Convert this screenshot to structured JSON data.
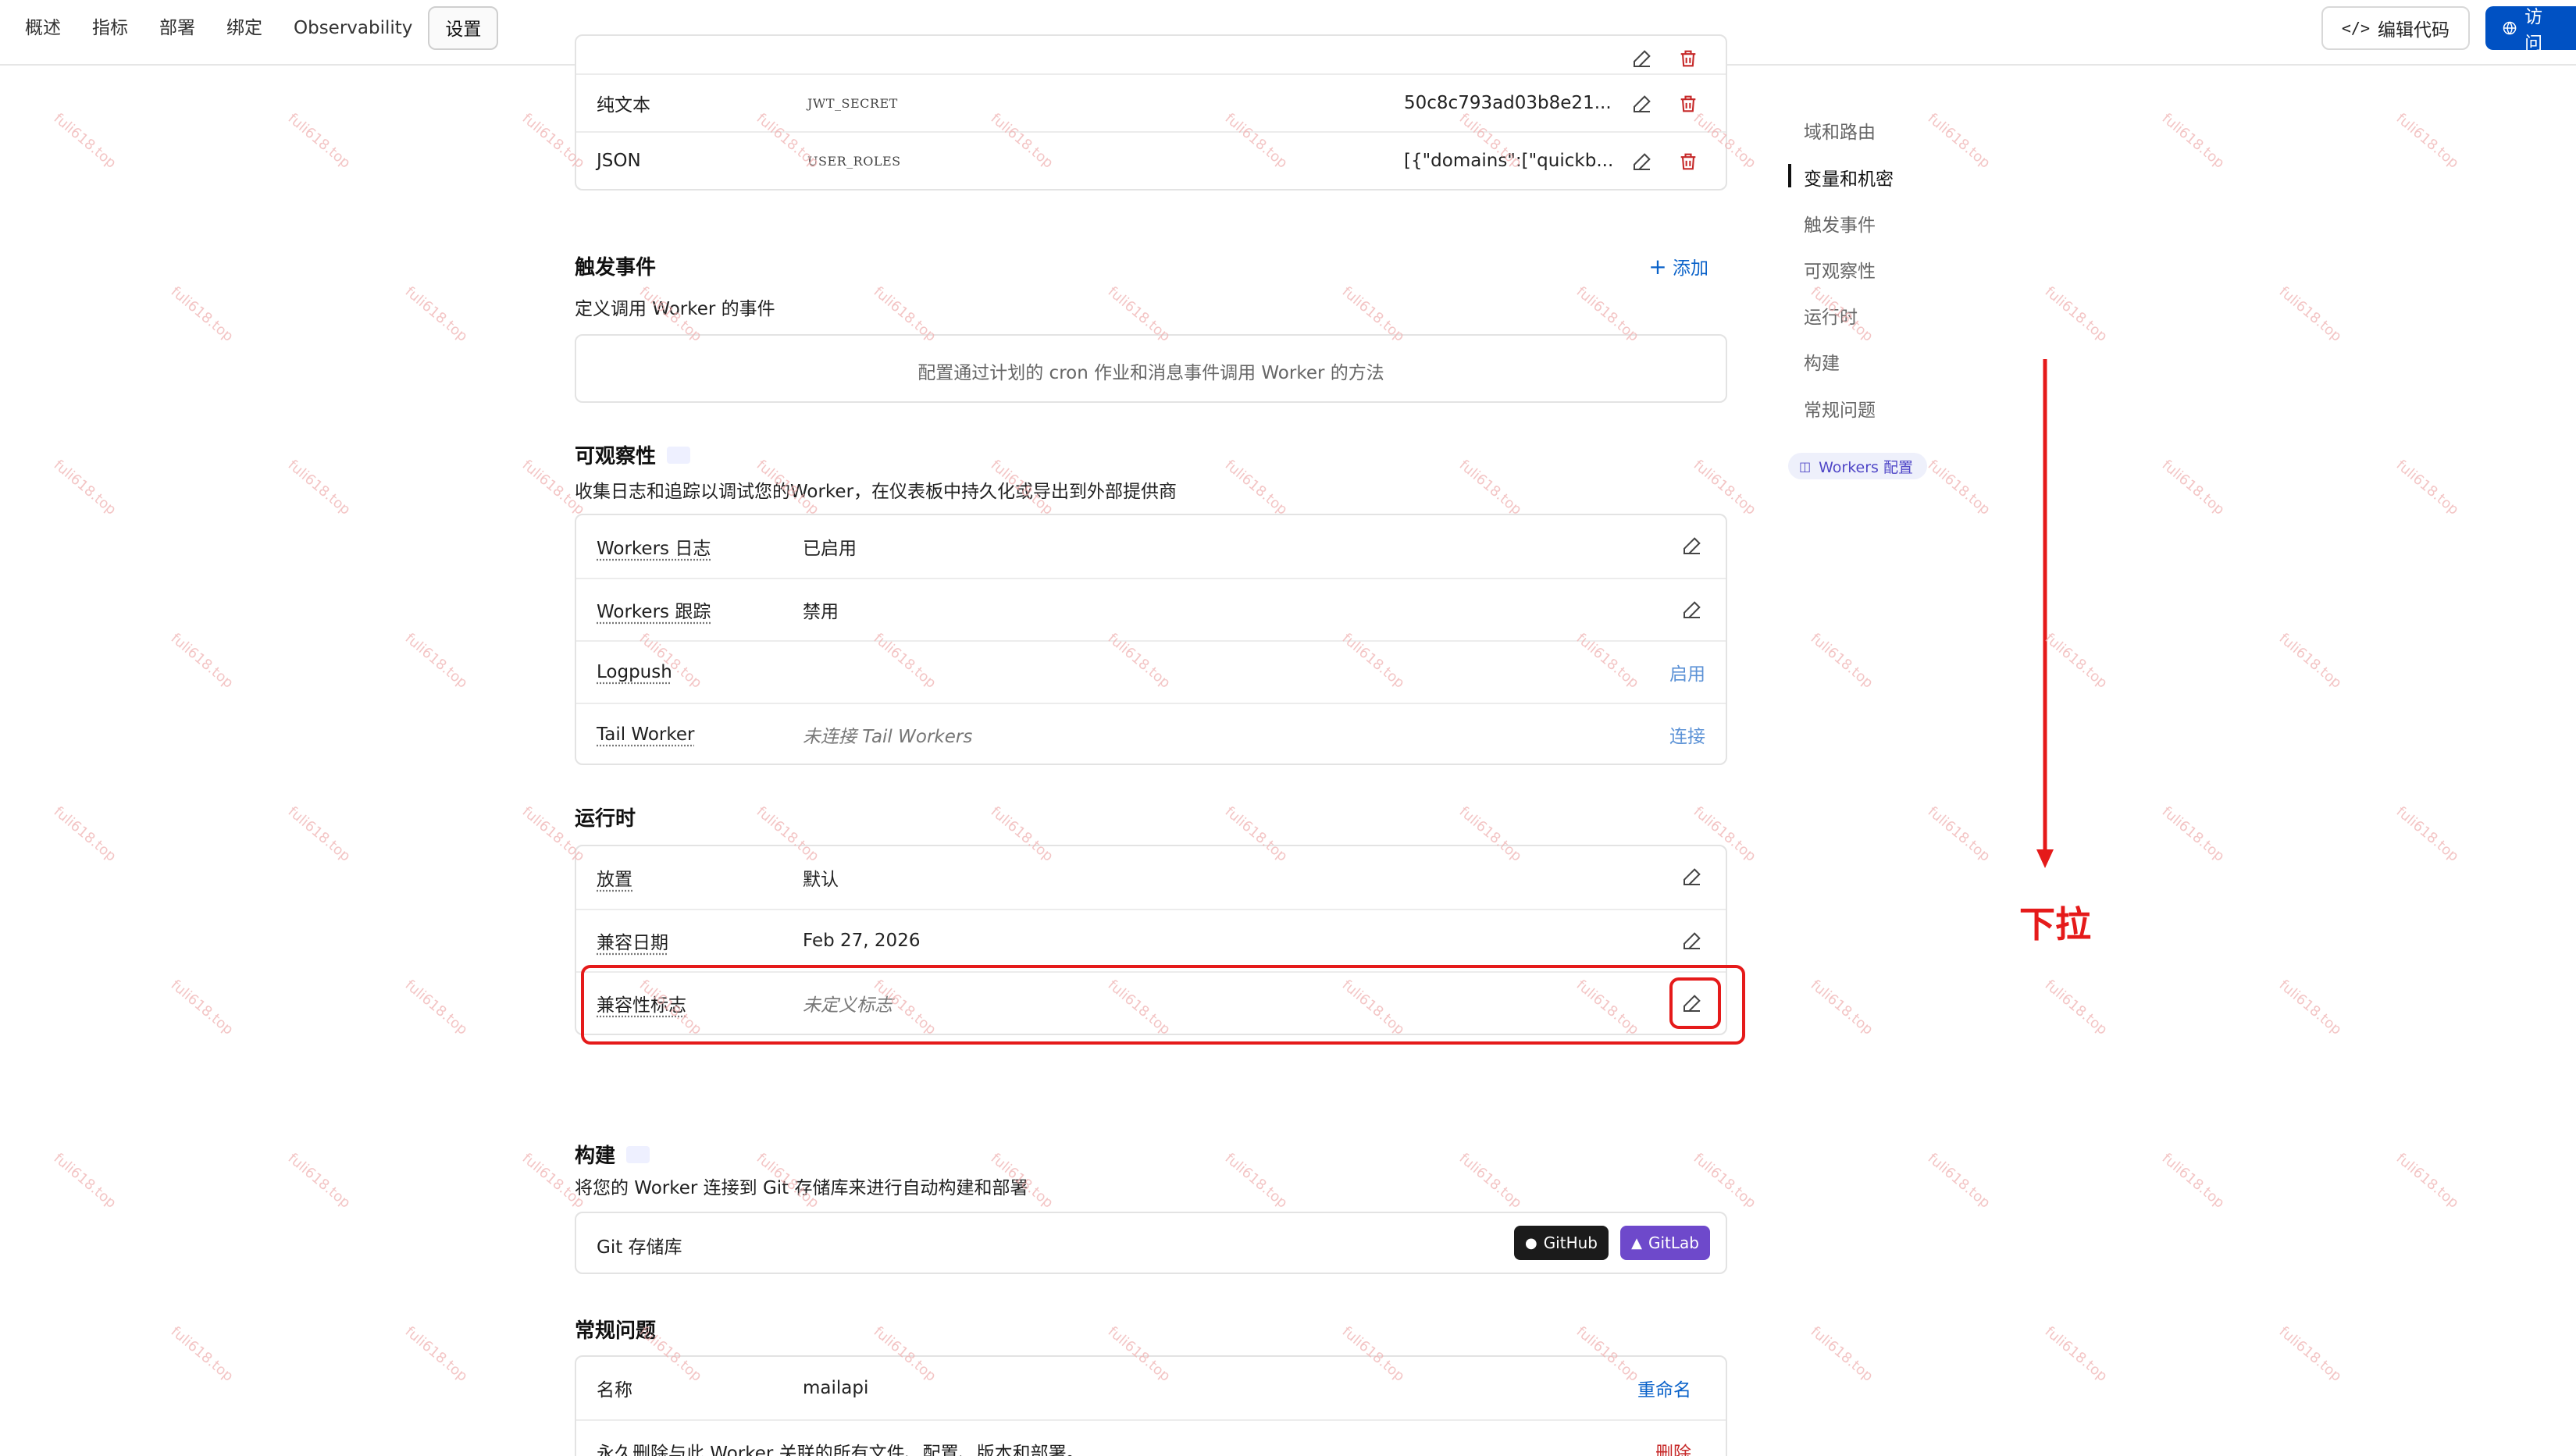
{
  "topbar": {
    "tabs": [
      "概述",
      "指标",
      "部署",
      "绑定",
      "Observability",
      "设置"
    ],
    "active_tab": "设置",
    "edit_code_label": "编辑代码",
    "visit_label": "访问"
  },
  "variables": {
    "rows": [
      {
        "type": "纯文本",
        "name": "JWT_SECRET",
        "value": "50c8c793ad03b8e21..."
      },
      {
        "type": "JSON",
        "name": "USER_ROLES",
        "value": "[{\"domains\":[\"quickb..."
      }
    ]
  },
  "triggers": {
    "title": "触发事件",
    "desc": "定义调用 Worker 的事件",
    "add_label": "添加",
    "empty_text": "配置通过计划的 cron 作业和消息事件调用 Worker 的方法"
  },
  "observability": {
    "title": "可观察性",
    "desc": "收集日志和追踪以调试您的Worker，在仪表板中持久化或导出到外部提供商",
    "rows": [
      {
        "label": "Workers 日志",
        "value": "已启用",
        "action": ""
      },
      {
        "label": "Workers 跟踪",
        "value": "禁用",
        "action": ""
      },
      {
        "label": "Logpush",
        "value": "",
        "action": "启用"
      },
      {
        "label": "Tail Worker",
        "value": "未连接 Tail Workers",
        "action": "连接"
      }
    ]
  },
  "runtime": {
    "title": "运行时",
    "rows": [
      {
        "label": "放置",
        "value": "默认"
      },
      {
        "label": "兼容日期",
        "value": "Feb 27, 2026"
      },
      {
        "label": "兼容性标志",
        "value": "未定义标志"
      }
    ]
  },
  "build": {
    "title": "构建",
    "desc": "将您的 Worker 连接到 Git 存储库来进行自动构建和部署",
    "repo_label": "Git 存储库",
    "github_label": "GitHub",
    "gitlab_label": "GitLab"
  },
  "general": {
    "title": "常规问题",
    "name_label": "名称",
    "name_value": "mailapi",
    "rename_label": "重命名",
    "delete_desc": "永久删除与此 Worker 关联的所有文件、配置、版本和部署。",
    "delete_label": "删除"
  },
  "toc": {
    "items": [
      "域和路由",
      "变量和机密",
      "触发事件",
      "可观察性",
      "运行时",
      "构建",
      "常规问题"
    ],
    "active": "变量和机密",
    "badge": "Workers 配置"
  },
  "annotation": {
    "pull_label": "下拉",
    "color": "#e51a1a"
  },
  "watermark": "fuli618.top",
  "colors": {
    "accent": "#0a62c9",
    "primary_button": "#0051c3",
    "danger": "#c62828"
  }
}
